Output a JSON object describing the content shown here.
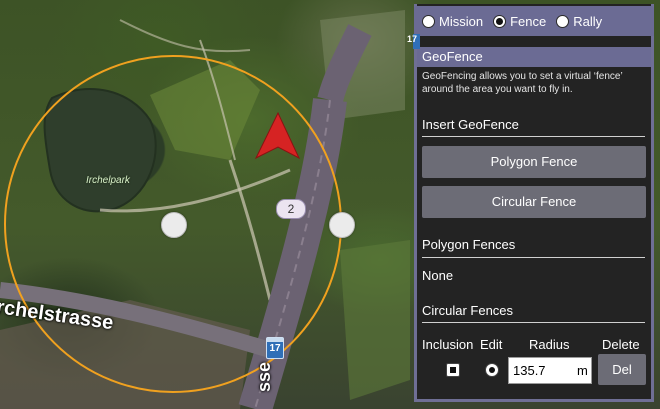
{
  "map": {
    "street_name": "rchelstrasse",
    "street_name_vertical": "sse",
    "park_label": "Irchelpark",
    "route_shield": "17",
    "route_shield_top": "17",
    "vehicle_badge": "2",
    "fence_color": "#f0a11f",
    "vehicle_color": "#d62323"
  },
  "plan_mode": {
    "options": [
      {
        "label": "Mission",
        "selected": false
      },
      {
        "label": "Fence",
        "selected": true
      },
      {
        "label": "Rally",
        "selected": false
      }
    ]
  },
  "geofence": {
    "header": "GeoFence",
    "description": "GeoFencing allows you to set a virtual ‘fence’ around the area you want to fly in.",
    "insert_heading": "Insert GeoFence",
    "polygon_button": "Polygon Fence",
    "circular_button": "Circular Fence",
    "polygon_list_heading": "Polygon Fences",
    "polygon_list_empty": "None",
    "circular_list_heading": "Circular Fences",
    "columns": {
      "inclusion": "Inclusion",
      "edit": "Edit",
      "radius": "Radius",
      "delete": "Delete"
    },
    "circle_row": {
      "inclusion": true,
      "edit": true,
      "radius": "135.7",
      "unit": "m",
      "delete_label": "Del"
    }
  }
}
